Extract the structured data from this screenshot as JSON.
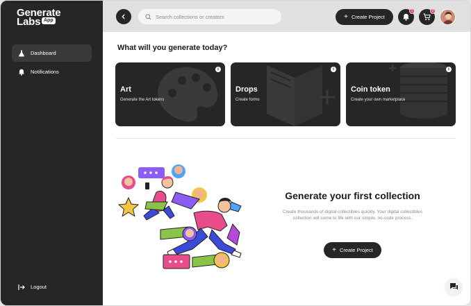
{
  "brand": {
    "line1": "Generate",
    "line2": "Labs",
    "badge": "App"
  },
  "sidebar": {
    "items": [
      {
        "label": "Dashboard",
        "icon": "flask-icon",
        "active": true
      },
      {
        "label": "Notifications",
        "icon": "bell-icon",
        "active": false
      }
    ],
    "logout": {
      "label": "Logout",
      "icon": "logout-icon"
    }
  },
  "topbar": {
    "search_placeholder": "Search collections or creators",
    "create_label": "Create Project",
    "notifications_count": "1",
    "cart_count": "0"
  },
  "main": {
    "heading": "What will you generate today?",
    "cards": [
      {
        "title": "Art",
        "subtitle": "Generate the Art tokens",
        "icon": "palette-icon"
      },
      {
        "title": "Drops",
        "subtitle": "Create forms",
        "icon": "book-icon"
      },
      {
        "title": "Coin token",
        "subtitle": "Create your own marketplace",
        "icon": "coins-icon"
      }
    ],
    "collection": {
      "title": "Generate your first collection",
      "description": "Create thousands of digital collectibles quickly. Your digital collectibles collection will come to life with our simple, no-code process.",
      "button_label": "Create Project"
    }
  },
  "colors": {
    "dark": "#262626",
    "topbar": "#e0e0e0",
    "accent_pink": "#e94c8a",
    "accent_purple": "#8b5cf6",
    "accent_yellow": "#f5c542",
    "accent_blue": "#4da3ff",
    "badge_red": "#e5484d"
  }
}
